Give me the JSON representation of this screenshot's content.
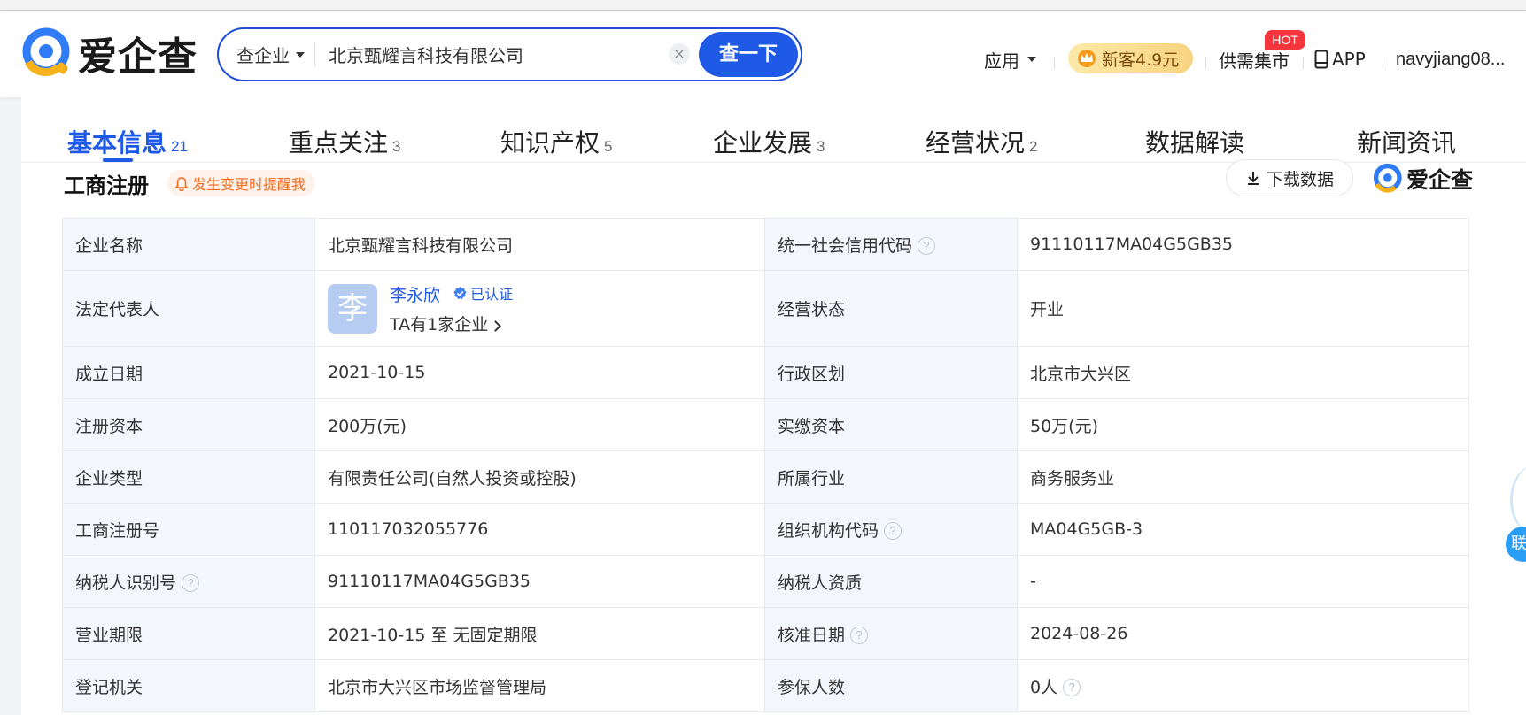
{
  "header": {
    "logo_text": "爱企查",
    "search": {
      "type_label": "查企业",
      "query": "北京甄耀言科技有限公司",
      "clear_symbol": "×",
      "button_label": "查一下"
    },
    "nav": {
      "app_menu": "应用",
      "vip_label": "新客4.9元",
      "supply_label": "供需集市",
      "hot_badge": "HOT",
      "app_link": "APP",
      "username": "navyjiang08..."
    }
  },
  "tabs": [
    {
      "label": "基本信息",
      "count": "21"
    },
    {
      "label": "重点关注",
      "count": "3"
    },
    {
      "label": "知识产权",
      "count": "5"
    },
    {
      "label": "企业发展",
      "count": "3"
    },
    {
      "label": "经营状况",
      "count": "2"
    },
    {
      "label": "数据解读",
      "count": ""
    },
    {
      "label": "新闻资讯",
      "count": ""
    }
  ],
  "section": {
    "title": "工商注册",
    "remind_label": "发生变更时提醒我",
    "download_label": "下载数据",
    "mini_logo_text": "爱企查"
  },
  "rep": {
    "avatar_char": "李",
    "name": "李永欣",
    "verified_label": "已认证",
    "company_count": "TA有1家企业"
  },
  "rows": [
    {
      "l1": "企业名称",
      "v1": "北京甄耀言科技有限公司",
      "l2": "统一社会信用代码",
      "v2": "91110117MA04G5GB35"
    },
    {
      "l1": "法定代表人",
      "v1": "",
      "l2": "经营状态",
      "v2": "开业"
    },
    {
      "l1": "成立日期",
      "v1": "2021-10-15",
      "l2": "行政区划",
      "v2": "北京市大兴区"
    },
    {
      "l1": "注册资本",
      "v1": "200万(元)",
      "l2": "实缴资本",
      "v2": "50万(元)"
    },
    {
      "l1": "企业类型",
      "v1": "有限责任公司(自然人投资或控股)",
      "l2": "所属行业",
      "v2": "商务服务业"
    },
    {
      "l1": "工商注册号",
      "v1": "110117032055776",
      "l2": "组织机构代码",
      "v2": "MA04G5GB-3"
    },
    {
      "l1": "纳税人识别号",
      "v1": "91110117MA04G5GB35",
      "l2": "纳税人资质",
      "v2": "-"
    },
    {
      "l1": "营业期限",
      "v1": "2021-10-15 至 无固定期限",
      "l2": "核准日期",
      "v2": "2024-08-26"
    },
    {
      "l1": "登记机关",
      "v1": "北京市大兴区市场监督管理局",
      "l2": "参保人数",
      "v2": "0人"
    }
  ],
  "help_symbol": "?",
  "float_button_label": "联",
  "colors": {
    "brand_blue": "#1f5ae6",
    "label_bg": "#f3f6fb",
    "hot_red": "#f5353c",
    "remind_orange": "#f26a1b"
  },
  "icons": [
    "logo-icon",
    "caret-down-icon",
    "clear-icon",
    "crown-icon",
    "phone-icon",
    "bell-icon",
    "download-icon",
    "verified-icon",
    "chevron-right-icon",
    "help-icon"
  ]
}
